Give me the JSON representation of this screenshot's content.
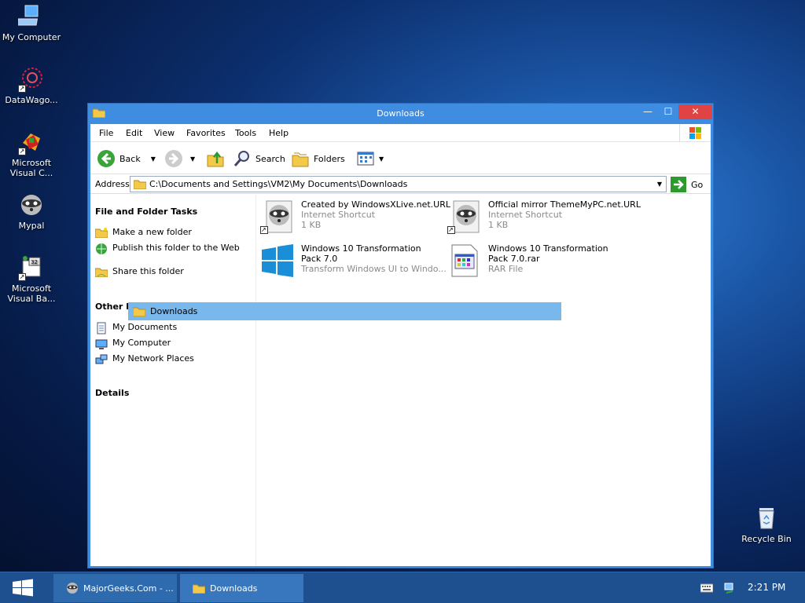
{
  "desktop": {
    "icons": [
      {
        "label": "My Computer",
        "icon": "computer-icon"
      },
      {
        "label": "DataWago...",
        "icon": "spiral-icon"
      },
      {
        "label": "Microsoft Visual C...",
        "icon": "visual-studio-icon"
      },
      {
        "label": "Mypal",
        "icon": "raccoon-icon"
      },
      {
        "label": "Microsoft Visual Ba...",
        "icon": "visual-basic-icon"
      },
      {
        "label": "Recycle Bin",
        "icon": "recycle-bin-icon"
      }
    ]
  },
  "window": {
    "title": "Downloads",
    "menu": [
      "File",
      "Edit",
      "View",
      "Favorites",
      "Tools",
      "Help"
    ],
    "toolbar": {
      "back": "Back",
      "search": "Search",
      "folders": "Folders"
    },
    "address": {
      "label": "Address",
      "value": "C:\\Documents and Settings\\VM2\\My Documents\\Downloads",
      "go": "Go"
    },
    "left_pane": {
      "tasks_title": "File and Folder Tasks",
      "tasks": [
        "Make a new folder",
        "Publish this folder to the Web",
        "Share this folder"
      ],
      "other_title": "Other Places",
      "places": [
        "My Documents",
        "My Computer",
        "My Network Places"
      ],
      "details_title": "Details"
    },
    "files": [
      {
        "name": "Created by WindowsXLive.net.URL",
        "type": "Internet Shortcut",
        "size": "1 KB",
        "icon": "raccoon-icon"
      },
      {
        "name": "Official mirror ThemeMyPC.net.URL",
        "type": "Internet Shortcut",
        "size": "1 KB",
        "icon": "raccoon-icon"
      },
      {
        "name": "Windows 10 Transformation Pack 7.0",
        "type": "Transform Windows UI to Windo...",
        "size": "",
        "icon": "windows-logo-icon"
      },
      {
        "name": "Windows 10 Transformation Pack 7.0.rar",
        "type": "RAR File",
        "size": "",
        "icon": "rar-file-icon"
      }
    ],
    "dropdown_selected": "Downloads"
  },
  "taskbar": {
    "tasks": [
      "MajorGeeks.Com - ...",
      "Downloads"
    ],
    "clock": "2:21 PM"
  },
  "colors": {
    "window_frame": "#3f8de0",
    "close_button": "#e04343",
    "selection": "#79b8ec",
    "taskbar": "#1e4f8f"
  }
}
